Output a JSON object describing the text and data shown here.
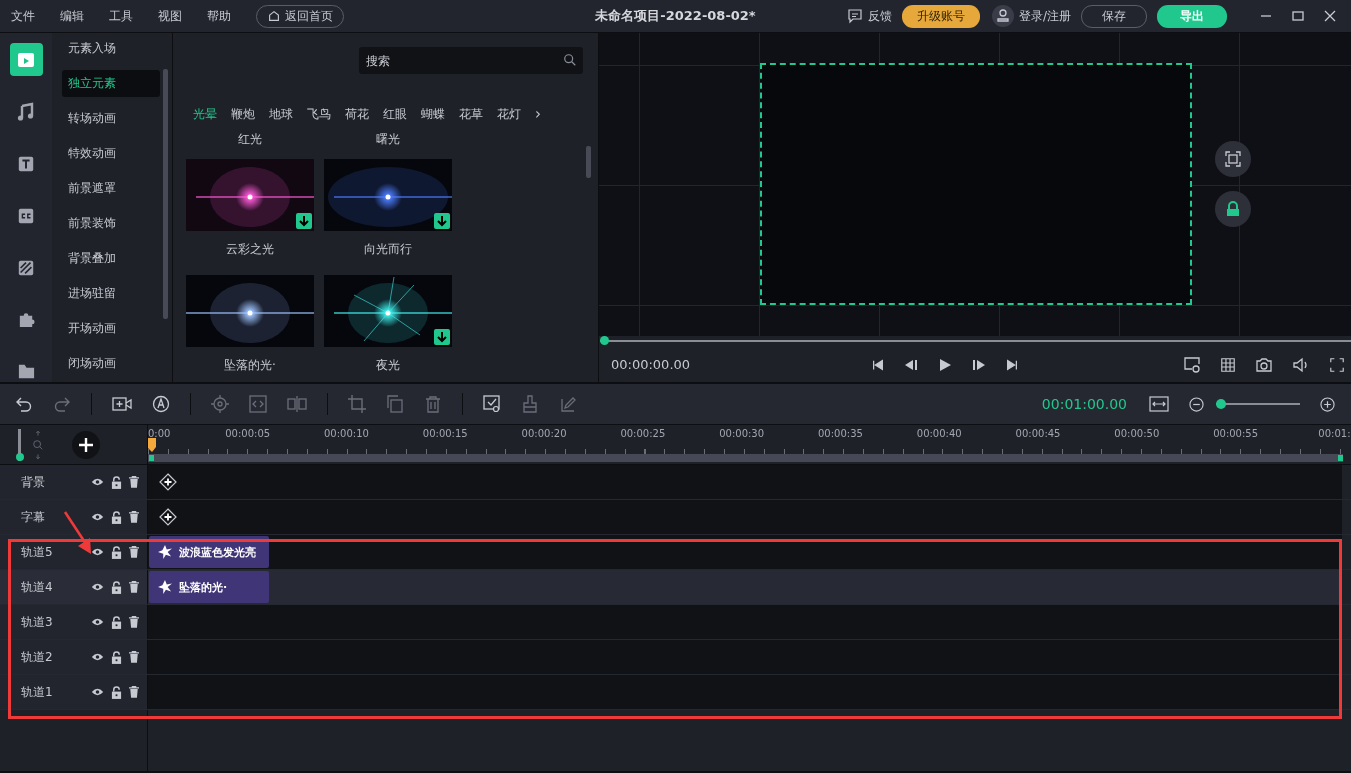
{
  "menu": [
    "文件",
    "编辑",
    "工具",
    "视图",
    "帮助"
  ],
  "home_button": "返回首页",
  "title": "未命名项目-2022-08-02*",
  "top_actions": {
    "feedback": "反馈",
    "upgrade": "升级账号",
    "login": "登录/注册",
    "save": "保存",
    "export": "导出"
  },
  "rail": [
    {
      "kind": "media",
      "selected": true
    },
    {
      "kind": "music",
      "selected": false
    },
    {
      "kind": "text",
      "selected": false
    },
    {
      "kind": "caption",
      "selected": false
    },
    {
      "kind": "filter",
      "selected": false
    },
    {
      "kind": "element",
      "selected": false
    },
    {
      "kind": "folder",
      "selected": false
    }
  ],
  "categories": [
    {
      "label": "元素入场",
      "selected": false
    },
    {
      "label": "独立元素",
      "selected": true
    },
    {
      "label": "转场动画",
      "selected": false
    },
    {
      "label": "特效动画",
      "selected": false
    },
    {
      "label": "前景遮罩",
      "selected": false
    },
    {
      "label": "前景装饰",
      "selected": false
    },
    {
      "label": "背景叠加",
      "selected": false
    },
    {
      "label": "进场驻留",
      "selected": false
    },
    {
      "label": "开场动画",
      "selected": false
    },
    {
      "label": "闭场动画",
      "selected": false
    }
  ],
  "search": {
    "placeholder": "搜索"
  },
  "asset_tabs": [
    {
      "label": "光晕",
      "selected": true
    },
    {
      "label": "鞭炮",
      "selected": false
    },
    {
      "label": "地球",
      "selected": false
    },
    {
      "label": "飞鸟",
      "selected": false
    },
    {
      "label": "荷花",
      "selected": false
    },
    {
      "label": "红眼",
      "selected": false
    },
    {
      "label": "蝴蝶",
      "selected": false
    },
    {
      "label": "花草",
      "selected": false
    },
    {
      "label": "花灯",
      "selected": false
    }
  ],
  "tabs_more": "›",
  "partial_labels": [
    "红光",
    "曙光"
  ],
  "assets": [
    {
      "name": "云彩之光",
      "download": true
    },
    {
      "name": "向光而行",
      "download": true
    },
    {
      "name": "坠落的光·",
      "download": false
    },
    {
      "name": "夜光",
      "download": true
    }
  ],
  "preview": {
    "time": "00:00:00.00",
    "level": 0
  },
  "duration": "00:01:00.00",
  "zoom": {
    "level": 0
  },
  "timeline_zoom": {
    "level": 0
  },
  "ruler": [
    "0:00",
    "00:00:05",
    "00:00:10",
    "00:00:15",
    "00:00:20",
    "00:00:25",
    "00:00:30",
    "00:00:35",
    "00:00:40",
    "00:00:45",
    "00:00:50",
    "00:00:55",
    "00:01:"
  ],
  "tracks": [
    {
      "name": "背景",
      "kind": "marker",
      "selected": false
    },
    {
      "name": "字幕",
      "kind": "marker",
      "selected": false
    },
    {
      "name": "轨道5",
      "kind": "clip",
      "clip": "波浪蓝色发光亮",
      "selected": false
    },
    {
      "name": "轨道4",
      "kind": "clip",
      "clip": "坠落的光·",
      "selected": true
    },
    {
      "name": "轨道3",
      "kind": "empty",
      "selected": false
    },
    {
      "name": "轨道2",
      "kind": "empty",
      "selected": false
    },
    {
      "name": "轨道1",
      "kind": "empty",
      "selected": false
    }
  ]
}
